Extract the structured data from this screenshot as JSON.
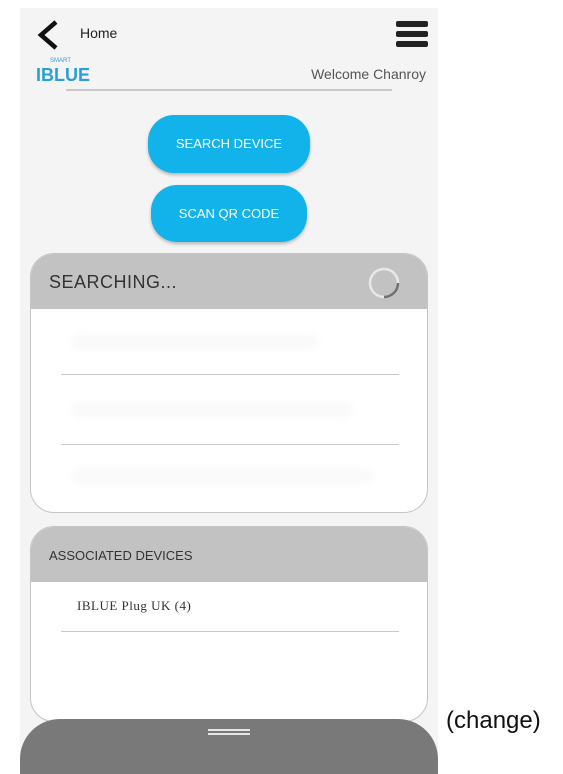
{
  "header": {
    "title": "Home",
    "welcome": "Welcome Chanroy",
    "back_icon": "chevron-left-icon",
    "menu_icon": "hamburger-menu-icon",
    "logo_text_small": "SMART",
    "logo_text": "IBLUE"
  },
  "actions": {
    "search_device": "SEARCH DEVICE",
    "scan_qr": "SCAN QR CODE"
  },
  "searching_card": {
    "title": "SEARCHING...",
    "spinner_icon": "loading-spinner-icon"
  },
  "associated_card": {
    "title": "ASSOCIATED DEVICES",
    "devices": [
      "IBLUE Plug UK (4)"
    ]
  },
  "bottom": {
    "handle_icon": "drag-handle-icon"
  },
  "annotation": "(change)",
  "colors": {
    "accent": "#12b2ea",
    "header_gray": "#c2c2c2",
    "bottom_bar": "#797979"
  }
}
